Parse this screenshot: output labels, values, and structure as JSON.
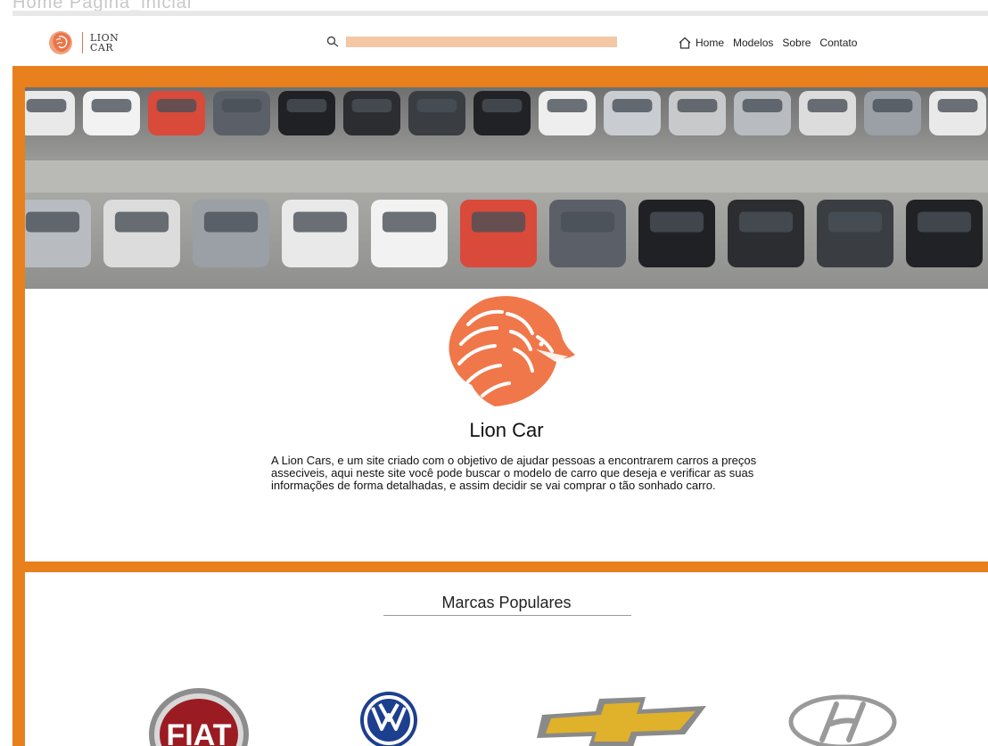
{
  "window": {
    "title_fragment": "Home Pagina_inicial"
  },
  "header": {
    "logo": {
      "line1": "LION",
      "line2": "CAR"
    },
    "search": {
      "placeholder": ""
    },
    "nav": {
      "home": "Home",
      "modelos": "Modelos",
      "sobre": "Sobre",
      "contato": "Contato"
    }
  },
  "about": {
    "title": "Lion Car",
    "text": "A Lion Cars, e um site criado com o objetivo de ajudar pessoas a encontrarem carros a preços asseciveis, aqui neste site você pode buscar o modelo de carro que deseja e verificar as suas informações de forma detalhadas, e assim decidir se vai comprar o tão sonhado carro."
  },
  "brands": {
    "title": "Marcas Populares",
    "items": [
      {
        "name": "FIAT",
        "icon": "fiat-logo"
      },
      {
        "name": "VW",
        "icon": "volkswagen-logo"
      },
      {
        "name": "",
        "icon": "chevrolet-logo"
      },
      {
        "name": "",
        "icon": "hyundai-logo"
      }
    ]
  },
  "colors": {
    "accent": "#e8801e",
    "lion": "#f0774a",
    "search_bar": "#f4c8a4"
  }
}
